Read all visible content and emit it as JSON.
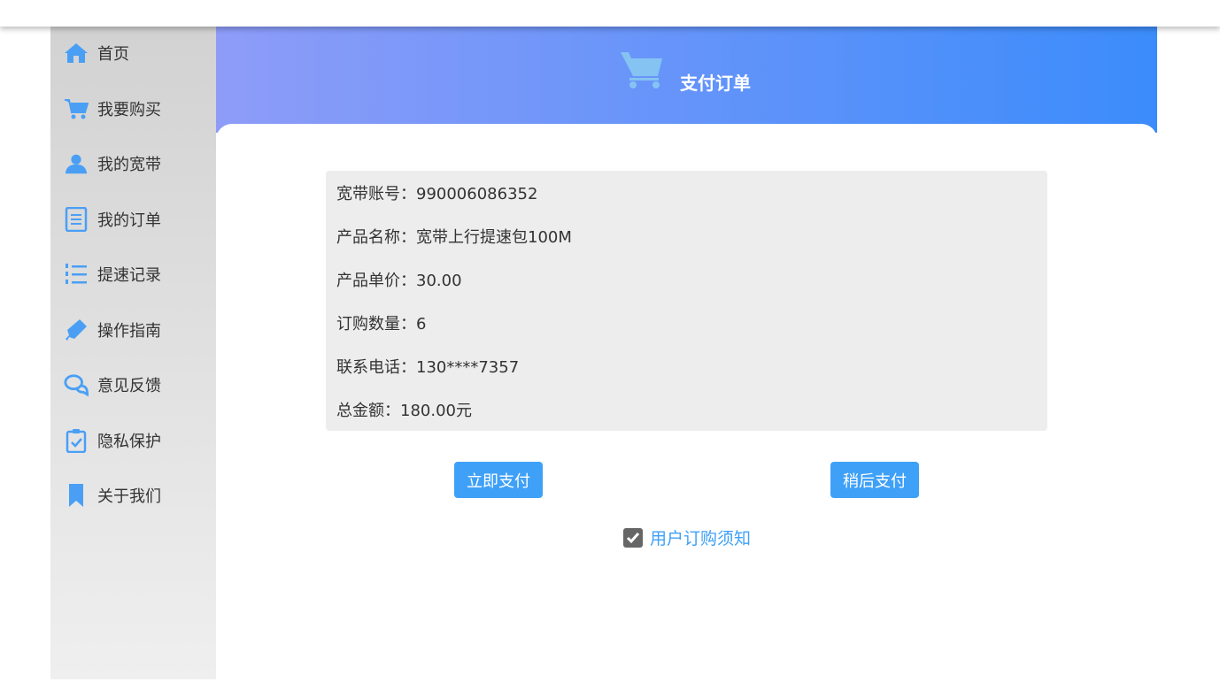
{
  "sidebar": {
    "items": [
      {
        "label": "首页",
        "icon": "home-icon"
      },
      {
        "label": "我要购买",
        "icon": "cart-icon"
      },
      {
        "label": "我的宽带",
        "icon": "user-icon"
      },
      {
        "label": "我的订单",
        "icon": "document-icon"
      },
      {
        "label": "提速记录",
        "icon": "list-icon"
      },
      {
        "label": "操作指南",
        "icon": "pen-icon"
      },
      {
        "label": "意见反馈",
        "icon": "chat-icon"
      },
      {
        "label": "隐私保护",
        "icon": "clipboard-check-icon"
      },
      {
        "label": "关于我们",
        "icon": "bookmark-icon"
      }
    ]
  },
  "header": {
    "title": "支付订单",
    "icon": "cart-icon"
  },
  "order": {
    "rows": [
      {
        "key": "宽带账号：",
        "value": "990006086352"
      },
      {
        "key": "产品名称：",
        "value": "宽带上行提速包100M"
      },
      {
        "key": "产品单价：",
        "value": "30.00"
      },
      {
        "key": "订购数量：",
        "value": "6"
      },
      {
        "key": "联系电话：",
        "value": "130****7357"
      },
      {
        "key": "总金额：",
        "value": "180.00元"
      }
    ]
  },
  "actions": {
    "pay_now": "立即支付",
    "pay_later": "稍后支付"
  },
  "agreement": {
    "label": "用户订购须知",
    "checked": true
  },
  "colors": {
    "accent": "#3fa0f7",
    "icon": "#4a9ff5"
  }
}
